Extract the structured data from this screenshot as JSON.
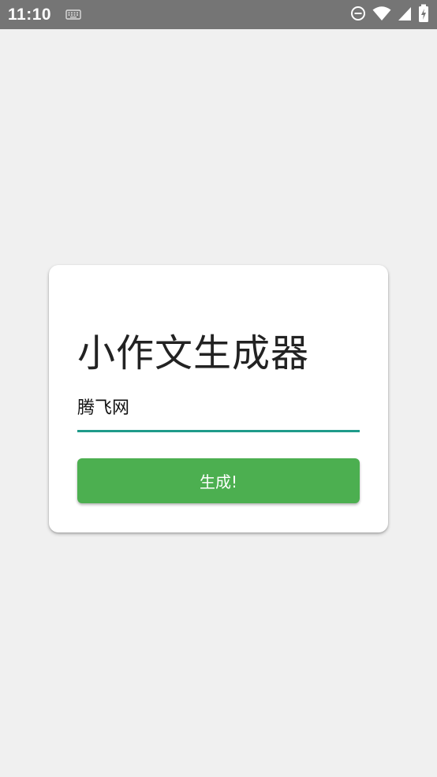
{
  "status_bar": {
    "time": "11:10",
    "icons": [
      "keyboard-icon",
      "do-not-disturb-icon",
      "wifi-icon",
      "cell-signal-icon",
      "battery-charging-icon"
    ],
    "background": "#757575"
  },
  "card": {
    "title": "小作文生成器",
    "input_value": "腾飞网",
    "button_label": "生成!"
  },
  "colors": {
    "page_background": "#f0f0f0",
    "accent_underline": "#1f9b8a",
    "button_green": "#4caf50"
  }
}
